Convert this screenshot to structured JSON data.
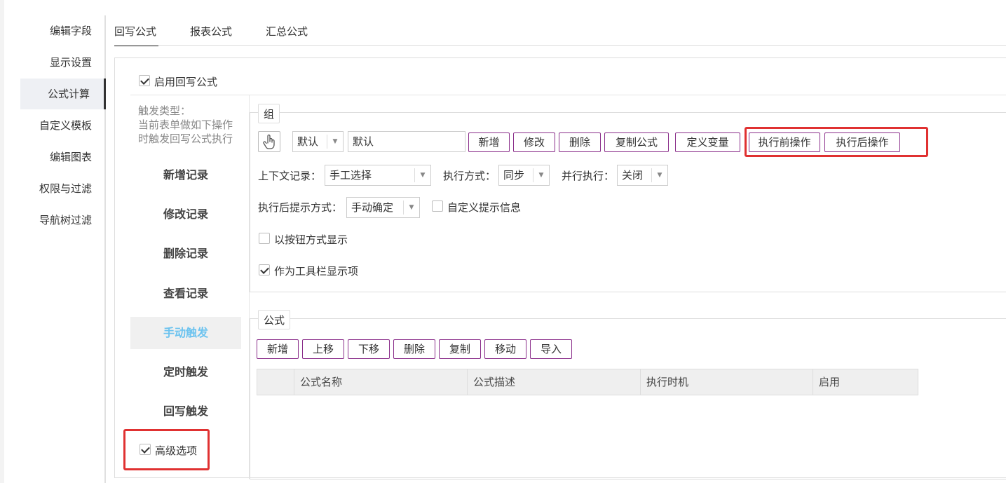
{
  "nav": {
    "items": [
      {
        "label": "编辑字段"
      },
      {
        "label": "显示设置"
      },
      {
        "label": "公式计算"
      },
      {
        "label": "自定义模板"
      },
      {
        "label": "编辑图表"
      },
      {
        "label": "权限与过滤"
      },
      {
        "label": "导航树过滤"
      }
    ],
    "active_index": 2
  },
  "tabs": [
    {
      "label": "回写公式"
    },
    {
      "label": "报表公式"
    },
    {
      "label": "汇总公式"
    }
  ],
  "enable_writeback": {
    "label": "启用回写公式",
    "checked": true
  },
  "trigger": {
    "title": "触发类型：",
    "desc_line1": "当前表单做如下操作",
    "desc_line2": "时触发回写公式执行",
    "items": [
      {
        "label": "新增记录"
      },
      {
        "label": "修改记录"
      },
      {
        "label": "删除记录"
      },
      {
        "label": "查看记录"
      },
      {
        "label": "手动触发"
      },
      {
        "label": "定时触发"
      },
      {
        "label": "回写触发"
      }
    ],
    "selected_index": 4
  },
  "advanced": {
    "label": "高级选项",
    "checked": true
  },
  "group": {
    "legend": "组",
    "icon": "hand-pointer-icon",
    "select_value": "默认",
    "name_value": "默认",
    "buttons": {
      "add": "新增",
      "edit": "修改",
      "delete": "删除",
      "copy_formula": "复制公式",
      "define_var": "定义变量",
      "pre_exec": "执行前操作",
      "post_exec": "执行后操作"
    },
    "context_label": "上下文记录：",
    "context_value": "手工选择",
    "exec_mode_label": "执行方式：",
    "exec_mode_value": "同步",
    "parallel_label": "并行执行：",
    "parallel_value": "关闭",
    "post_prompt_label": "执行后提示方式：",
    "post_prompt_value": "手动确定",
    "custom_prompt": {
      "label": "自定义提示信息",
      "checked": false
    },
    "show_as_button": {
      "label": "以按钮方式显示",
      "checked": false
    },
    "toolbar_item": {
      "label": "作为工具栏显示项",
      "checked": true
    }
  },
  "formula": {
    "legend": "公式",
    "buttons": {
      "add": "新增",
      "up": "上移",
      "down": "下移",
      "delete": "删除",
      "copy": "复制",
      "move": "移动",
      "import": "导入"
    },
    "columns": [
      "公式名称",
      "公式描述",
      "执行时机",
      "启用"
    ]
  },
  "colors": {
    "button_border": "#8a2e8a",
    "highlight_red": "#e03131",
    "selected_trigger": "#6cc3ef"
  }
}
